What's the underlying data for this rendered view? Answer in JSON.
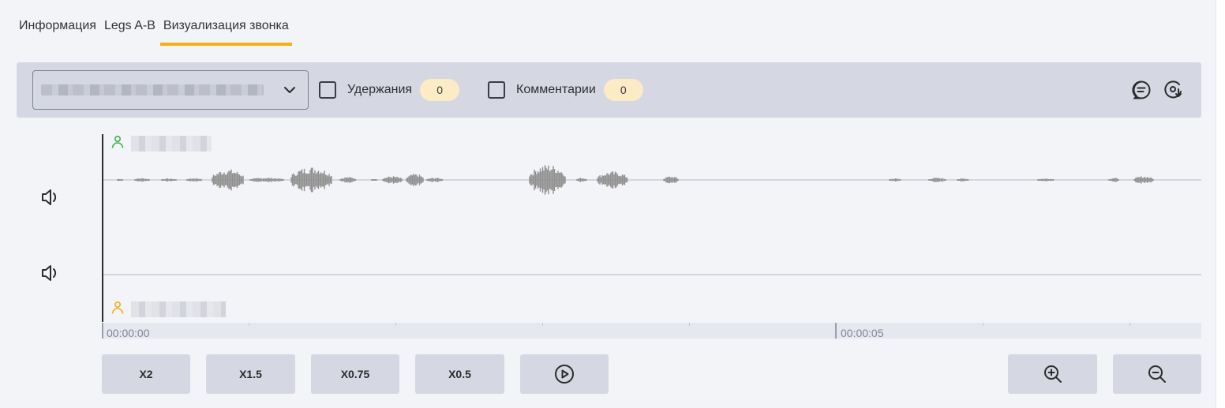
{
  "tabs": [
    {
      "label": "Информация"
    },
    {
      "label": "Legs A-B"
    },
    {
      "label": "Визуализация звонка",
      "active": true
    }
  ],
  "toolbar": {
    "holds": {
      "label": "Удержания",
      "count": "0"
    },
    "comments": {
      "label": "Комментарии",
      "count": "0"
    }
  },
  "timeline": {
    "labels": [
      "00:00:00",
      "00:00:05"
    ]
  },
  "controls": {
    "speeds": [
      "X2",
      "X1.5",
      "X0.75",
      "X0.5"
    ]
  },
  "colors": {
    "accent": "#f5b014",
    "speaker_a": "#3cb04a",
    "speaker_b": "#f5b014",
    "waveform": "#8e8e8e",
    "toolbar_bg": "#d5d8e3"
  },
  "icons": {
    "comment": "comment-icon",
    "download": "record-download-icon",
    "volume": "volume-icon",
    "play": "play-icon",
    "zoom_in": "zoom-in-icon",
    "zoom_out": "zoom-out-icon"
  }
}
